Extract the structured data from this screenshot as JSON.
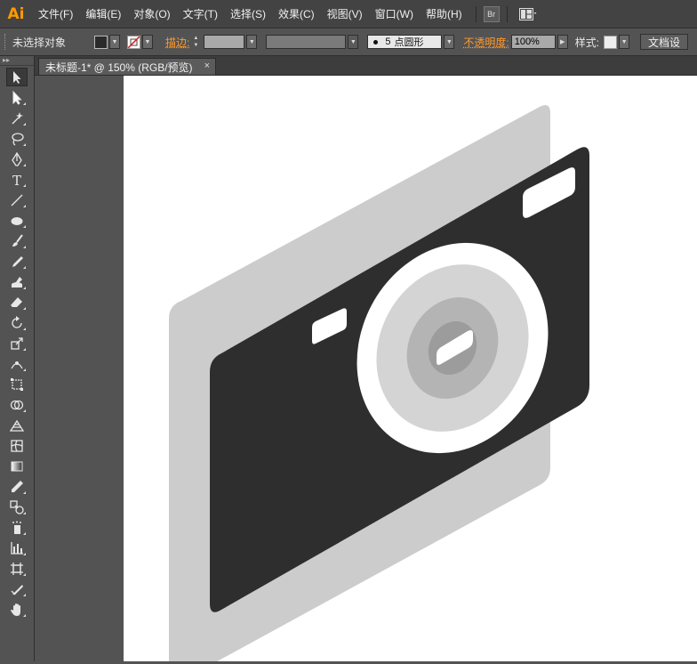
{
  "app": {
    "logo": "Ai",
    "accent_color": "#ff9a00"
  },
  "menu": {
    "items": [
      "文件(F)",
      "编辑(E)",
      "对象(O)",
      "文字(T)",
      "选择(S)",
      "效果(C)",
      "视图(V)",
      "窗口(W)",
      "帮助(H)"
    ],
    "bridge_label": "Br"
  },
  "control_bar": {
    "selection_status": "未选择对象",
    "stroke_label": "描边:",
    "brush_size": "5",
    "brush_name": "点圆形",
    "opacity_label": "不透明度:",
    "opacity_value": "100%",
    "style_label": "样式:",
    "doc_setup_button": "文档设"
  },
  "document": {
    "tab_title": "未标题-1* @ 150% (RGB/预览)",
    "close_glyph": "×"
  },
  "artwork": {
    "back_panel_color": "#cccccc",
    "body_color": "#2e2e2e",
    "lens_ring_color": "#ffffff",
    "lens_outer_color": "#d4d4d4",
    "lens_mid_color": "#b4b4b4",
    "lens_inner_color": "#9c9c9c",
    "window_color": "#ffffff"
  },
  "tools": [
    "selection-tool",
    "direct-selection-tool",
    "magic-wand-tool",
    "lasso-tool",
    "pen-tool",
    "type-tool",
    "line-segment-tool",
    "ellipse-tool",
    "paintbrush-tool",
    "pencil-tool",
    "blob-brush-tool",
    "eraser-tool",
    "rotate-tool",
    "scale-tool",
    "width-tool",
    "free-transform-tool",
    "shape-builder-tool",
    "perspective-grid-tool",
    "mesh-tool",
    "gradient-tool",
    "eyedropper-tool",
    "blend-tool",
    "symbol-sprayer-tool",
    "column-graph-tool",
    "artboard-tool",
    "slice-tool",
    "hand-tool"
  ]
}
